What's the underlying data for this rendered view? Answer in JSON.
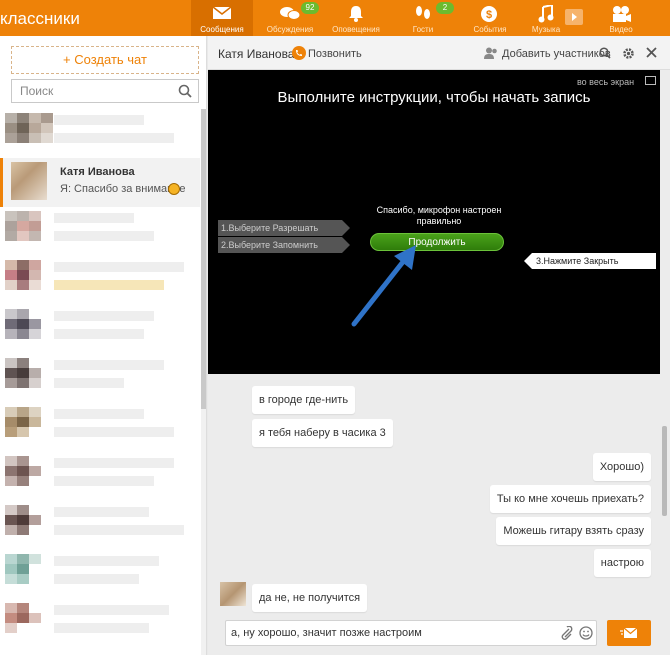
{
  "topbar": {
    "brand": "классники",
    "nav": [
      {
        "label": "Сообщения",
        "icon": "envelope-icon",
        "active": true
      },
      {
        "label": "Обсуждения",
        "icon": "chat-bubbles-icon",
        "badge": "92"
      },
      {
        "label": "Оповещения",
        "icon": "bell-icon"
      },
      {
        "label": "Гости",
        "icon": "footprints-icon",
        "badge": "2"
      },
      {
        "label": "События",
        "icon": "events-icon"
      },
      {
        "label": "Музыка",
        "icon": "music-icon"
      },
      {
        "label": "Видео",
        "icon": "video-camera-icon"
      }
    ]
  },
  "sidebar": {
    "create_chat": "Создать чат",
    "search_placeholder": "Поиск",
    "active_chat": {
      "name": "Катя Иванова",
      "preview": "Я: Спасибо за внимание"
    }
  },
  "chat": {
    "header": {
      "name": "Катя Иванова",
      "call": "Позвонить",
      "add_participants": "Добавить участников"
    },
    "overlay": {
      "full_screen": "во весь экран",
      "title": "Выполните инструкции, чтобы начать запись",
      "mic_ok": "Спасибо, микрофон настроен правильно",
      "continue": "Продолжить",
      "step1": "1.Выберите Разрешать",
      "step2": "2.Выберите Запомнить",
      "step3": "3.Нажмите Закрыть"
    },
    "messages": [
      {
        "text": "в городе где-нить",
        "side": "in"
      },
      {
        "text": "я тебя наберу в часика 3",
        "side": "in"
      },
      {
        "text": "Хорошо)",
        "side": "out"
      },
      {
        "text": "Ты ко мне хочешь приехать?",
        "side": "out"
      },
      {
        "text": "Можешь гитару взять сразу",
        "side": "out"
      },
      {
        "text": "настрою",
        "side": "out"
      },
      {
        "text": "да не, не получится",
        "side": "in"
      }
    ],
    "composer_text": "а, ну хорошо, значит позже настроим"
  },
  "colors": {
    "accent": "#ee8208",
    "green": "#3d8f14",
    "arrow": "#2f73c8"
  }
}
